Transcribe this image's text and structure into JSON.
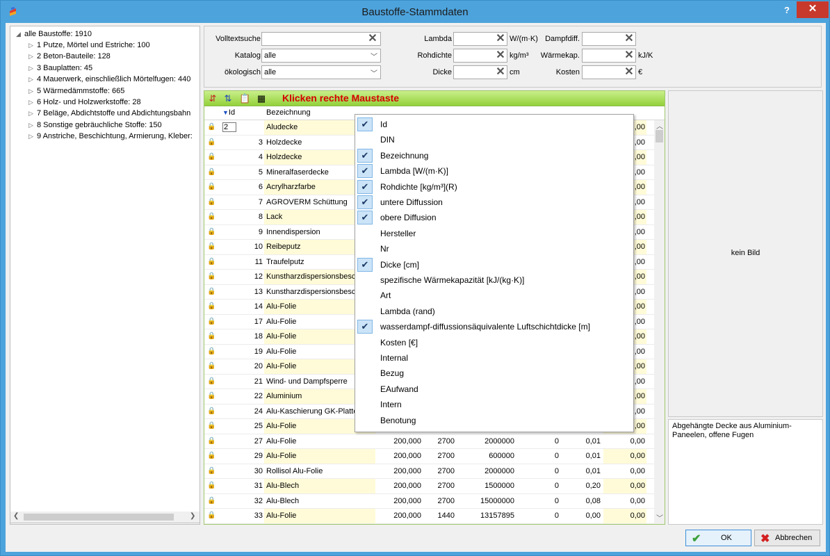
{
  "window": {
    "title": "Baustoffe-Stammdaten",
    "help": "?",
    "close": "✕"
  },
  "tree": {
    "root": "alle Baustoffe: 1910",
    "items": [
      "1 Putze, Mörtel und Estriche: 100",
      "2 Beton-Bauteile: 128",
      "3 Bauplatten: 45",
      "4 Mauerwerk, einschließlich Mörtelfugen: 440",
      "5 Wärmedämmstoffe: 665",
      "6 Holz- und Holzwerkstoffe: 28",
      "7 Beläge, Abdichtstoffe und Abdichtungsbahn",
      "8 Sonstige gebräuchliche Stoffe: 150",
      "9 Anstriche, Beschichtung, Armierung, Kleber:"
    ]
  },
  "filter": {
    "volltext_label": "Volltextsuche",
    "volltext_value": "",
    "katalog_label": "Katalog",
    "katalog_value": "alle",
    "oeko_label": "ökologisch",
    "oeko_value": "alle",
    "lambda_label": "Lambda",
    "lambda_unit": "W/(m·K)",
    "rohdichte_label": "Rohdichte",
    "rohdichte_unit": "kg/m³",
    "dicke_label": "Dicke",
    "dicke_unit": "cm",
    "dampf_label": "Dampfdiff.",
    "waerme_label": "Wärmekap.",
    "waerme_unit": "kJ/K",
    "kosten_label": "Kosten",
    "kosten_unit": "€"
  },
  "grid": {
    "hint": "Klicken rechte Maustaste",
    "col_id": "Id",
    "col_name": "Bezeichnung",
    "first_id": "2",
    "rows": [
      {
        "id": "",
        "name": "Aludecke",
        "c5": ",00"
      },
      {
        "id": "3",
        "name": "Holzdecke",
        "c5": ",00"
      },
      {
        "id": "4",
        "name": "Holzdecke",
        "c5": ",00"
      },
      {
        "id": "5",
        "name": "Mineralfaserdecke",
        "c5": ",00"
      },
      {
        "id": "6",
        "name": "Acrylharzfarbe",
        "c5": ",00"
      },
      {
        "id": "7",
        "name": "AGROVERM Schüttung",
        "c5": ",00"
      },
      {
        "id": "8",
        "name": "Lack",
        "c5": ",00"
      },
      {
        "id": "9",
        "name": "Innendispersion",
        "c5": ",00"
      },
      {
        "id": "10",
        "name": "Reibeputz",
        "c5": ",00"
      },
      {
        "id": "11",
        "name": "Traufelputz",
        "c5": ",00"
      },
      {
        "id": "12",
        "name": "Kunstharzdispersionsbesch",
        "c5": ",00"
      },
      {
        "id": "13",
        "name": "Kunstharzdispersionsbesch",
        "c5": ",00"
      },
      {
        "id": "14",
        "name": "Alu-Folie",
        "c5": ",00"
      },
      {
        "id": "17",
        "name": "Alu-Folie",
        "c5": ",00"
      },
      {
        "id": "18",
        "name": "Alu-Folie",
        "c5": ",00"
      },
      {
        "id": "19",
        "name": "Alu-Folie",
        "c5": ",00"
      },
      {
        "id": "20",
        "name": "Alu-Folie",
        "c5": ",00"
      },
      {
        "id": "21",
        "name": "Wind- und Dampfsperre",
        "c5": ",00"
      },
      {
        "id": "22",
        "name": "Aluminium",
        "c5": ",00"
      },
      {
        "id": "24",
        "name": "Alu-Kaschierung GK-Platte",
        "c5": ",00"
      },
      {
        "id": "25",
        "name": "Alu-Folie",
        "c5": ",00"
      },
      {
        "id": "27",
        "name": "Alu-Folie",
        "c1": "200,000",
        "c2": "2700",
        "c3": "2000000",
        "c4": "0",
        "c4b": "0,01",
        "c5": "0,00"
      },
      {
        "id": "29",
        "name": "Alu-Folie",
        "c1": "200,000",
        "c2": "2700",
        "c3": "600000",
        "c4": "0",
        "c4b": "0,01",
        "c5": "0,00"
      },
      {
        "id": "30",
        "name": "Rollisol Alu-Folie",
        "c1": "200,000",
        "c2": "2700",
        "c3": "2000000",
        "c4": "0",
        "c4b": "0,01",
        "c5": "0,00"
      },
      {
        "id": "31",
        "name": "Alu-Blech",
        "c1": "200,000",
        "c2": "2700",
        "c3": "1500000",
        "c4": "0",
        "c4b": "0,20",
        "c5": "0,00"
      },
      {
        "id": "32",
        "name": "Alu-Blech",
        "c1": "200,000",
        "c2": "2700",
        "c3": "15000000",
        "c4": "0",
        "c4b": "0,08",
        "c5": "0,00"
      },
      {
        "id": "33",
        "name": "Alu-Folie",
        "c1": "200,000",
        "c2": "1440",
        "c3": "13157895",
        "c4": "0",
        "c4b": "0,00",
        "c5": "0,00"
      }
    ]
  },
  "menu": [
    {
      "label": "Id",
      "checked": true
    },
    {
      "label": "DIN",
      "checked": false
    },
    {
      "label": "Bezeichnung",
      "checked": true
    },
    {
      "label": "Lambda [W/(m·K)]",
      "checked": true
    },
    {
      "label": "Rohdichte [kg/m³](R)",
      "checked": true
    },
    {
      "label": "untere Diffussion",
      "checked": true
    },
    {
      "label": "obere Diffusion",
      "checked": true
    },
    {
      "label": "Hersteller",
      "checked": false
    },
    {
      "label": "Nr",
      "checked": false
    },
    {
      "label": "Dicke [cm]",
      "checked": true
    },
    {
      "label": "spezifische Wärmekapazität [kJ/(kg·K)]",
      "checked": false
    },
    {
      "label": "Art",
      "checked": false
    },
    {
      "label": "Lambda (rand)",
      "checked": false
    },
    {
      "label": "wasserdampf-diffussionsäquivalente Luftschichtdicke [m]",
      "checked": true
    },
    {
      "label": "Kosten [€]",
      "checked": false
    },
    {
      "label": "Internal",
      "checked": false
    },
    {
      "label": "Bezug",
      "checked": false
    },
    {
      "label": "EAufwand",
      "checked": false
    },
    {
      "label": "Intern",
      "checked": false
    },
    {
      "label": "Benotung",
      "checked": false
    }
  ],
  "image_panel": {
    "text": "kein Bild"
  },
  "description": "Abgehängte Decke aus Aluminium-Paneelen, offene Fugen",
  "buttons": {
    "ok": "OK",
    "cancel": "Abbrechen"
  }
}
